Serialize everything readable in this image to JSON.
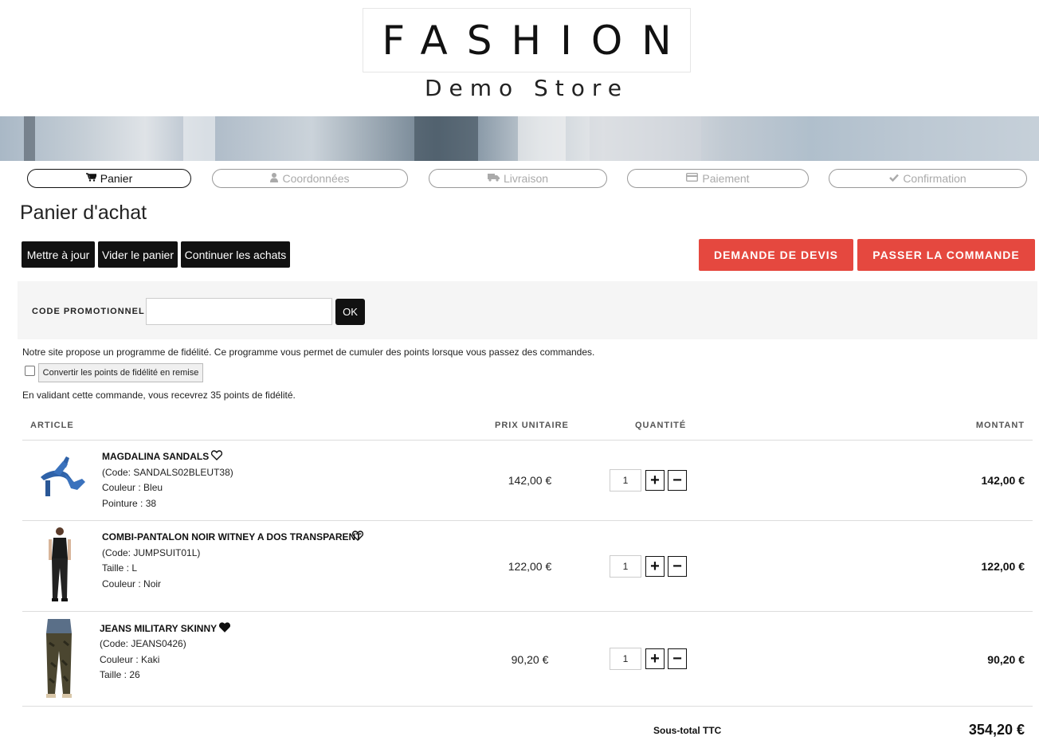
{
  "brand": {
    "title": "FASHION",
    "subtitle": "Demo Store"
  },
  "steps": [
    {
      "label": "Panier",
      "icon": "cart-icon",
      "active": true
    },
    {
      "label": "Coordonnées",
      "icon": "user-icon",
      "active": false
    },
    {
      "label": "Livraison",
      "icon": "truck-icon",
      "active": false
    },
    {
      "label": "Paiement",
      "icon": "credit-card-icon",
      "active": false
    },
    {
      "label": "Confirmation",
      "icon": "check-icon",
      "active": false
    }
  ],
  "page_title": "Panier d'achat",
  "actions": {
    "update": "Mettre à jour",
    "empty": "Vider le panier",
    "continue": "Continuer les achats",
    "quote": "DEMANDE DE DEVIS",
    "order": "PASSER LA COMMANDE"
  },
  "promo": {
    "label": "CODE PROMOTIONNEL :",
    "value": "",
    "ok": "OK"
  },
  "loyalty": {
    "info": "Notre site propose un programme de fidélité. Ce programme vous permet de cumuler des points lorsque vous passez des commandes.",
    "convert": "Convertir les points de fidélité en remise",
    "points": "En validant cette commande, vous recevrez 35 points de fidélité."
  },
  "table": {
    "headers": {
      "article": "ARTICLE",
      "unit_price": "PRIX UNITAIRE",
      "quantity": "QUANTITÉ",
      "amount": "MONTANT"
    },
    "rows": [
      {
        "name": "MAGDALINA SANDALS",
        "code": "(Code: SANDALS02BLEUT38)",
        "attr1": "Couleur : Bleu",
        "attr2": "Pointure : 38",
        "price": "142,00 €",
        "qty": "1",
        "amount": "142,00 €",
        "favorite": false
      },
      {
        "name": "COMBI-PANTALON NOIR WITNEY A DOS TRANSPARENT",
        "code": "(Code: JUMPSUIT01L)",
        "attr1": "Taille : L",
        "attr2": "Couleur : Noir",
        "price": "122,00 €",
        "qty": "1",
        "amount": "122,00 €",
        "favorite": false
      },
      {
        "name": "JEANS MILITARY SKINNY",
        "code": "(Code: JEANS0426)",
        "attr1": "Couleur : Kaki",
        "attr2": "Taille : 26",
        "price": "90,20 €",
        "qty": "1",
        "amount": "90,20 €",
        "favorite": true
      }
    ],
    "qty_plus": "+",
    "qty_minus": "−"
  },
  "subtotal": {
    "label": "Sous-total TTC",
    "value": "354,20 €"
  },
  "colors": {
    "accent_red": "#e5483f",
    "dark": "#111111",
    "muted": "#aaaaaa"
  }
}
